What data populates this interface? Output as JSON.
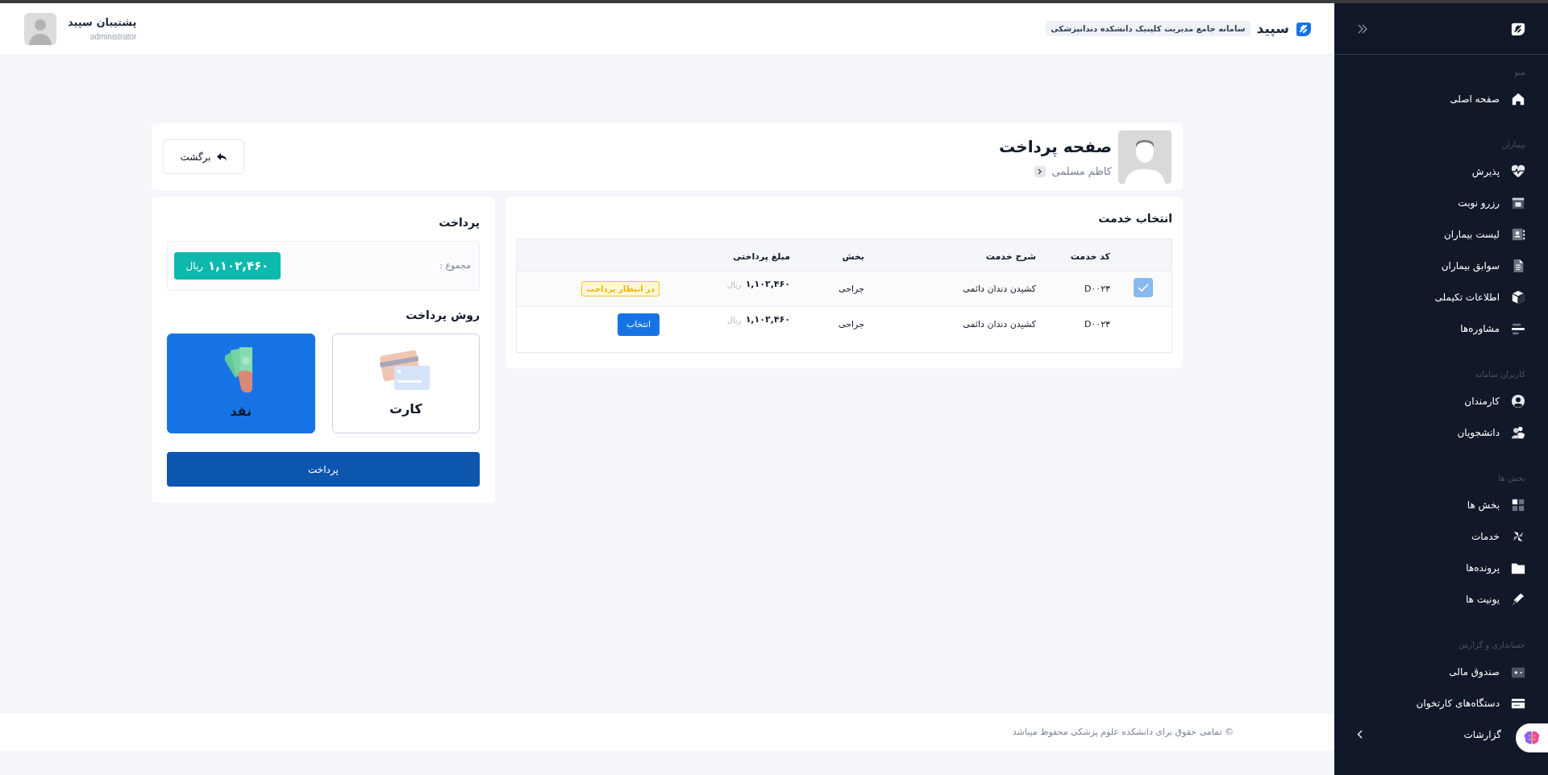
{
  "header": {
    "brand": "سپید",
    "subtitle": "سامانه جامع مدیریت کلینیک دانشکده دندانپزشکی",
    "user_name": "پشتیبان سپید",
    "user_role": "administrator"
  },
  "sidebar": {
    "sections": [
      {
        "title": "منو",
        "items": [
          {
            "label": "صفحه اصلی"
          }
        ]
      },
      {
        "title": "بیماران",
        "items": [
          {
            "label": "پذیرش"
          },
          {
            "label": "رزرو نوبت"
          },
          {
            "label": "لیست بیماران"
          },
          {
            "label": "سوابق بیماران"
          },
          {
            "label": "اطلاعات تکیملی"
          },
          {
            "label": "مشاوره‌ها"
          }
        ]
      },
      {
        "title": "کاربران سامانه",
        "items": [
          {
            "label": "کارمندان"
          },
          {
            "label": "دانشجویان"
          }
        ]
      },
      {
        "title": "بخش ها",
        "items": [
          {
            "label": "بخش ها"
          },
          {
            "label": "خدمات"
          },
          {
            "label": "پرونده‌ها"
          },
          {
            "label": "یونیت ها"
          }
        ]
      },
      {
        "title": "حسابداری و گزارش",
        "items": [
          {
            "label": "صندوق مالی"
          },
          {
            "label": "دستگاه‌های کارتخوان"
          },
          {
            "label": "گزارشات",
            "expandable": true
          }
        ]
      }
    ]
  },
  "page": {
    "title": "صفحه پرداخت",
    "patient": "کاظم مسلمی",
    "back": "برگشت"
  },
  "services": {
    "title": "انتخاب خدمت",
    "columns": [
      "کد خدمت",
      "شرح خدمت",
      "بخش",
      "مبلغ پرداختی"
    ],
    "rows": [
      {
        "selected": true,
        "checked": true,
        "code": "D۰۰۲۳",
        "description": "کشیدن دندان دائمی",
        "section": "جراحی",
        "amount": "۱,۱۰۲,۴۶۰",
        "currency": "ریال",
        "action": {
          "kind": "badge",
          "label": "در انتظار پرداخت"
        }
      },
      {
        "selected": false,
        "checked": false,
        "code": "D۰۰۲۳",
        "description": "کشیدن دندان دائمی",
        "section": "جراحی",
        "amount": "۱,۱۰۲,۴۶۰",
        "currency": "ریال",
        "action": {
          "kind": "button",
          "label": "انتخاب"
        }
      }
    ]
  },
  "payment": {
    "title": "پرداخت",
    "total_label": "مجموع :",
    "total": "۱,۱۰۲,۴۶۰",
    "currency": "ریال",
    "methods_title": "روش پرداخت",
    "methods": [
      {
        "kind": "card",
        "label": "کارت",
        "selected": false
      },
      {
        "kind": "cash",
        "label": "نقد",
        "selected": true
      }
    ],
    "submit": "پرداخت"
  },
  "footer": "© تمامی حقوق برای دانشکده علوم پزشکی محفوظ میباشد"
}
